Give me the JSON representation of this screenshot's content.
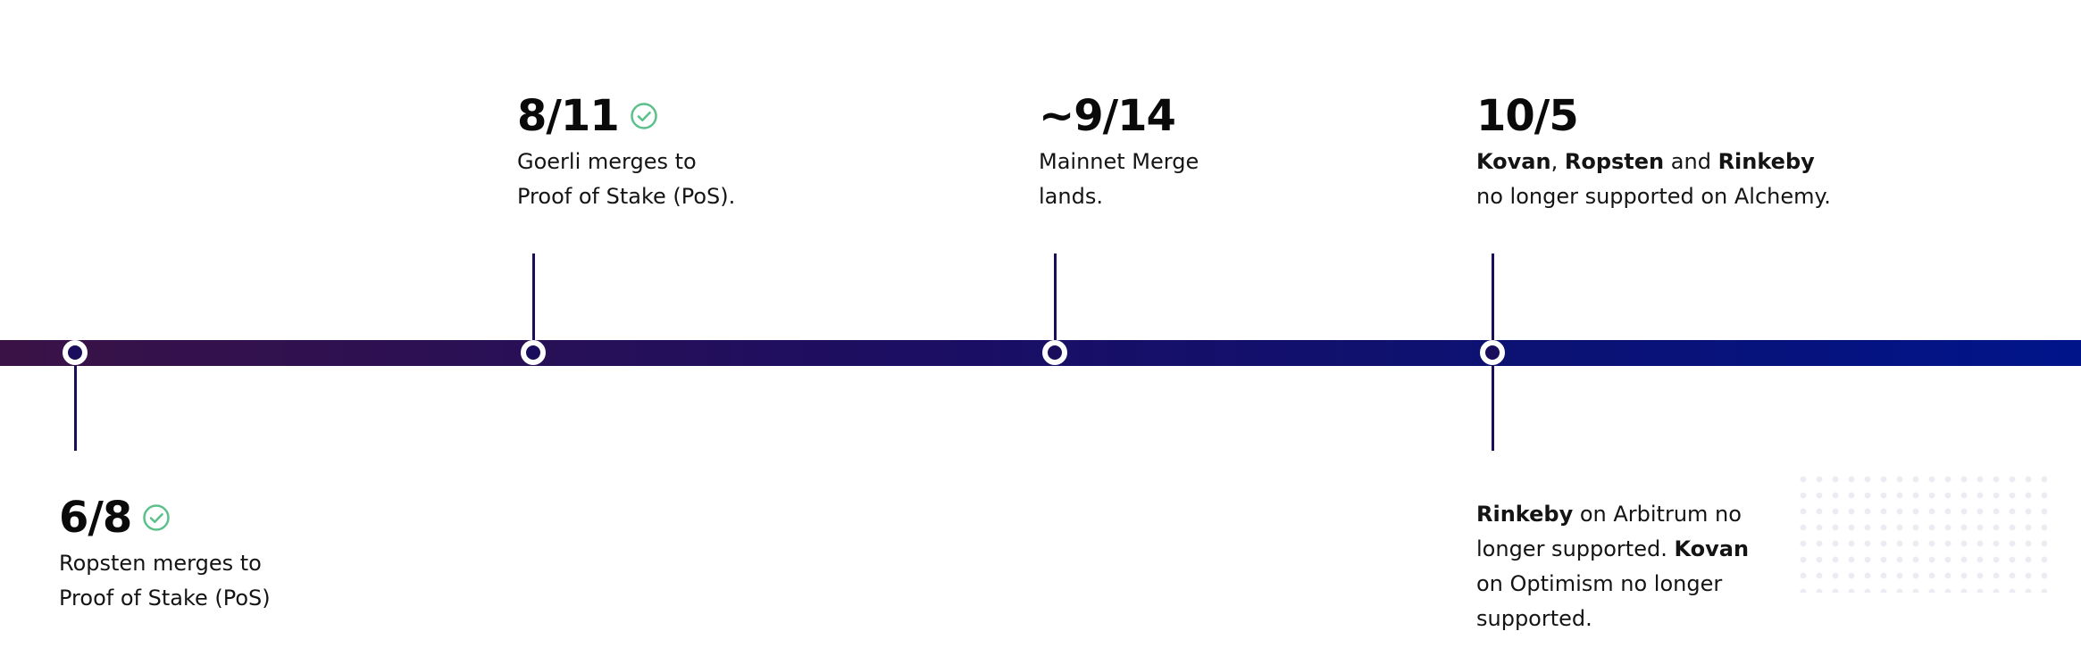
{
  "events": [
    {
      "date": "6/8",
      "completed": true,
      "lines": [
        "Ropsten merges to",
        "Proof of Stake (PoS)"
      ]
    },
    {
      "date": "8/11",
      "completed": true,
      "lines": [
        "Goerli merges to",
        "Proof of Stake (PoS)."
      ]
    },
    {
      "date": "~9/14",
      "completed": false,
      "lines": [
        "Mainnet Merge",
        "lands."
      ]
    },
    {
      "date": "10/5",
      "completed": false,
      "line1": {
        "b1": "Kovan",
        "sep1": ", ",
        "b2": "Ropsten",
        "sep2": " and ",
        "b3": "Rinkeby"
      },
      "line2": "no longer supported on Alchemy.",
      "below": {
        "b1": "Rinkeby",
        "t1": " on Arbitrum no",
        "t2": "longer supported. ",
        "b2": "Kovan",
        "t3": "on Optimism no longer",
        "t4": "supported."
      }
    }
  ],
  "colors": {
    "check": "#5cc08a",
    "node": "#1a0d5c",
    "bar_start": "#3a1246",
    "bar_end": "#00148a"
  },
  "icons": {
    "completed": "check-circle-icon"
  }
}
